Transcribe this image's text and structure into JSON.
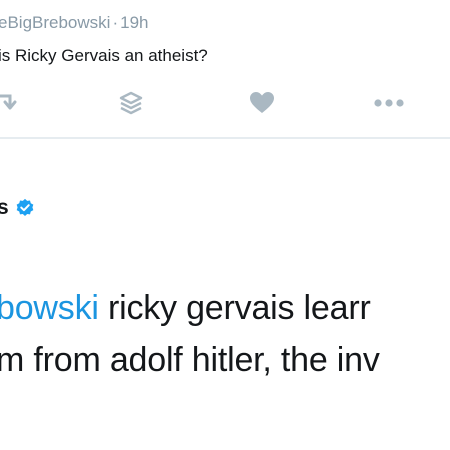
{
  "original_tweet": {
    "handle_fragment": "eBigBrebowski",
    "separator": "·",
    "time": "19h",
    "text": "is Ricky Gervais an atheist?"
  },
  "actions": {
    "icons": [
      "retweet-icon",
      "stack-icon",
      "heart-icon",
      "more-icon"
    ],
    "icon_color": "#aab8c2"
  },
  "reply": {
    "author_fragment": "s",
    "verified": true,
    "verified_color": "#1da1f2",
    "line1_mention": "bowski",
    "line1_text": " ricky gervais learr",
    "line2_text": "m from adolf hitler, the inv"
  }
}
